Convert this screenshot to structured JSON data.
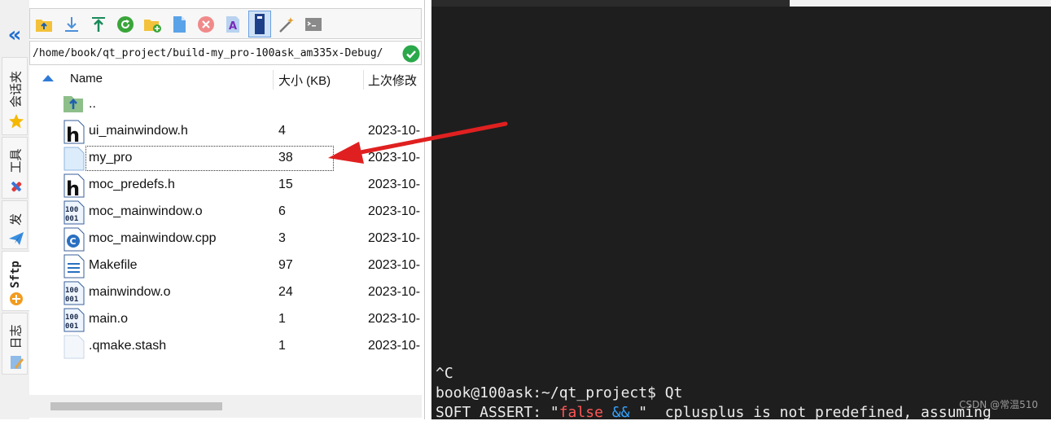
{
  "sidebar": {
    "tabs": [
      {
        "label": "会话夹",
        "icon": "star-icon"
      },
      {
        "label": "工具",
        "icon": "tools-icon"
      },
      {
        "label": "发",
        "icon": "paper-plane-icon"
      },
      {
        "label": "Sftp",
        "icon": "sftp-icon"
      },
      {
        "label": "日志",
        "icon": "log-icon"
      }
    ],
    "active_tab": "Sftp"
  },
  "toolbar": {
    "buttons": [
      "parent-folder-icon",
      "download-icon",
      "upload-icon",
      "refresh-icon",
      "new-folder-icon",
      "new-file-icon",
      "delete-icon",
      "rename-icon",
      "selected-mode-icon",
      "magic-wand-icon",
      "terminal-icon"
    ]
  },
  "path": {
    "value": "/home/book/qt_project/build-my_pro-100ask_am335x-Debug/"
  },
  "columns": {
    "name": "Name",
    "size": "大小 (KB)",
    "modified": "上次修改"
  },
  "files": [
    {
      "name": "..",
      "size": "",
      "date": "",
      "icon": "parent-folder-icon"
    },
    {
      "name": "ui_mainwindow.h",
      "size": "4",
      "date": "2023-10-",
      "icon": "header-file-icon"
    },
    {
      "name": "my_pro",
      "size": "38",
      "date": "2023-10-",
      "icon": "blank-file-icon"
    },
    {
      "name": "moc_predefs.h",
      "size": "15",
      "date": "2023-10-",
      "icon": "header-file-icon"
    },
    {
      "name": "moc_mainwindow.o",
      "size": "6",
      "date": "2023-10-",
      "icon": "binary-file-icon"
    },
    {
      "name": "moc_mainwindow.cpp",
      "size": "3",
      "date": "2023-10-",
      "icon": "cpp-file-icon"
    },
    {
      "name": "Makefile",
      "size": "97",
      "date": "2023-10-",
      "icon": "text-file-icon"
    },
    {
      "name": "mainwindow.o",
      "size": "24",
      "date": "2023-10-",
      "icon": "binary-file-icon"
    },
    {
      "name": "main.o",
      "size": "1",
      "date": "2023-10-",
      "icon": "binary-file-icon"
    },
    {
      "name": ".qmake.stash",
      "size": "1",
      "date": "2023-10-",
      "icon": "blank-file-icon"
    }
  ],
  "terminal": {
    "line1": "^C",
    "line2": "book@100ask:~/qt_project$ Qt",
    "line3_a": "SOFT ASSERT: \"",
    "line3_red": "false",
    "line3_b": " ",
    "line3_blue": "&&",
    "line3_c": " \"  cplusplus is not predefined, assuming"
  },
  "watermark": "CSDN @常温510",
  "colors": {
    "accent": "#2f7ad8",
    "terminal_bg": "#1e1e1e",
    "arrow": "#e02020",
    "ok_green": "#2aa84a"
  }
}
